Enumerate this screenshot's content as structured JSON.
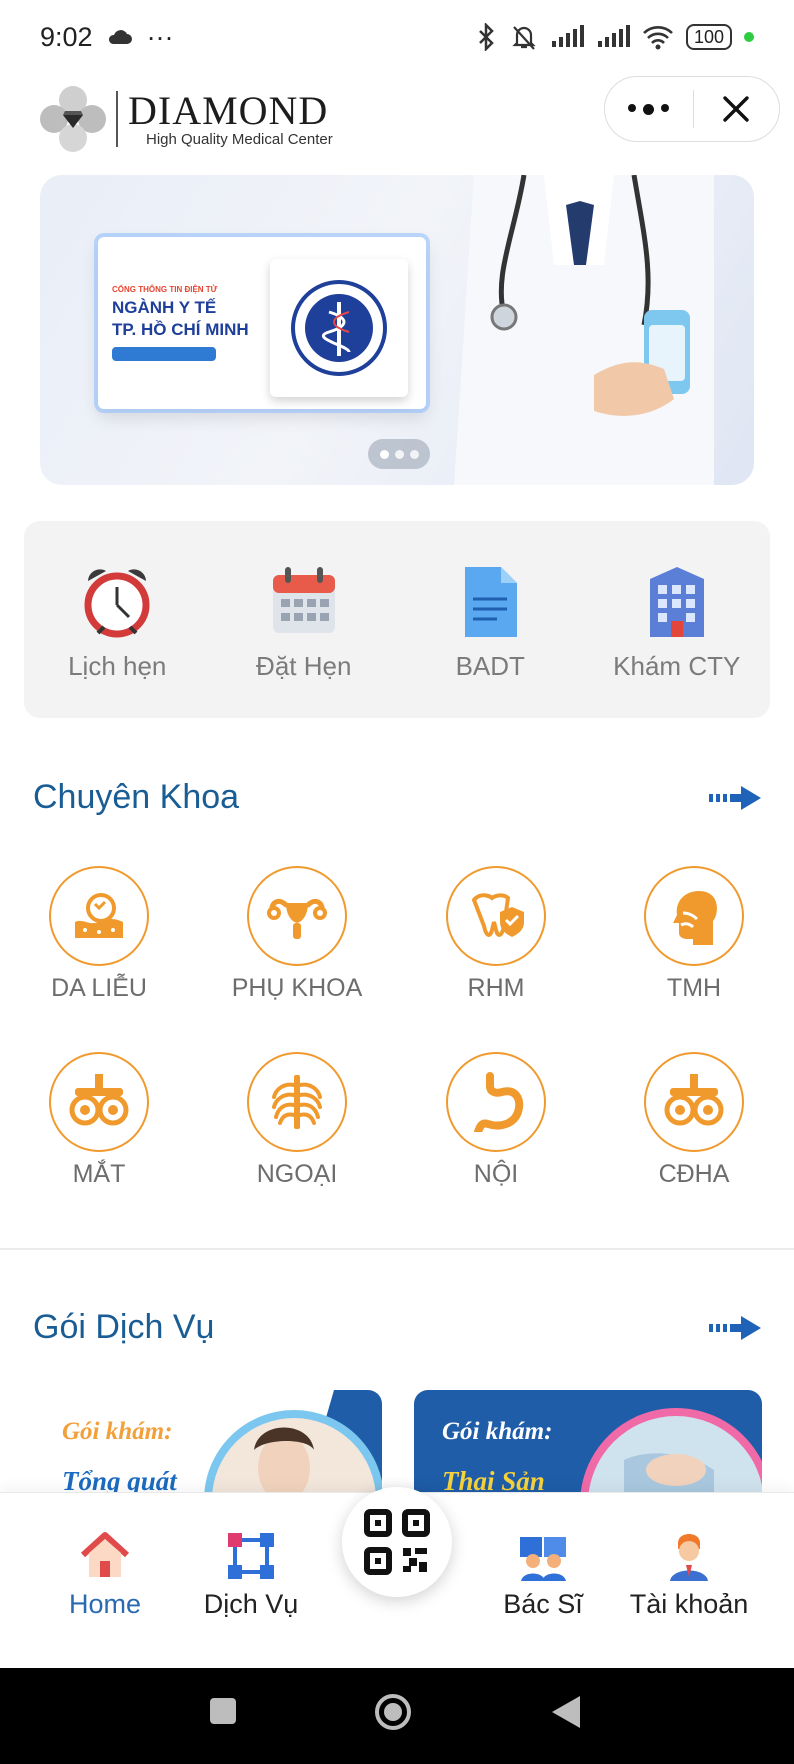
{
  "status_bar": {
    "time": "9:02",
    "more": "···",
    "battery": "100"
  },
  "header": {
    "brand": "DIAMOND",
    "tagline": "High Quality Medical Center"
  },
  "banner": {
    "portal_kicker": "CỔNG THÔNG TIN ĐIỆN TỬ",
    "portal_title_line1": "NGÀNH Y TẾ",
    "portal_title_line2": "TP. HỒ CHÍ MINH",
    "slides": 3,
    "active_slide": 1
  },
  "quick_menu": [
    {
      "label": "Lịch hẹn",
      "icon": "alarm-clock-icon"
    },
    {
      "label": "Đặt Hẹn",
      "icon": "calendar-icon"
    },
    {
      "label": "BADT",
      "icon": "document-icon"
    },
    {
      "label": "Khám CTY",
      "icon": "office-building-icon"
    }
  ],
  "specialties": {
    "title": "Chuyên Khoa",
    "items": [
      {
        "label": "DA LIỄU",
        "icon": "skin-icon"
      },
      {
        "label": "PHỤ KHOA",
        "icon": "uterus-icon"
      },
      {
        "label": "RHM",
        "icon": "tooth-shield-icon"
      },
      {
        "label": "TMH",
        "icon": "ent-head-icon"
      },
      {
        "label": "MẮT",
        "icon": "eye-exam-icon"
      },
      {
        "label": "NGOẠI",
        "icon": "ribcage-icon"
      },
      {
        "label": "NỘI",
        "icon": "stomach-icon"
      },
      {
        "label": "CĐHA",
        "icon": "imaging-icon"
      }
    ]
  },
  "packages": {
    "title": "Gói Dịch Vụ",
    "items": [
      {
        "title": "Gói khám:",
        "subtitle": "Tổng quát"
      },
      {
        "title": "Gói khám:",
        "subtitle": "Thai Sản"
      }
    ]
  },
  "bottom_nav": [
    {
      "label": "Home",
      "icon": "home-icon",
      "active": true
    },
    {
      "label": "Dịch Vụ",
      "icon": "services-icon",
      "active": false
    },
    {
      "label": "Bác Sĩ",
      "icon": "doctors-icon",
      "active": false
    },
    {
      "label": "Tài khoản",
      "icon": "account-icon",
      "active": false
    }
  ],
  "colors": {
    "accent_blue": "#1a5d94",
    "specialty_orange": "#f09a2e",
    "nav_active": "#2a6ab3"
  }
}
